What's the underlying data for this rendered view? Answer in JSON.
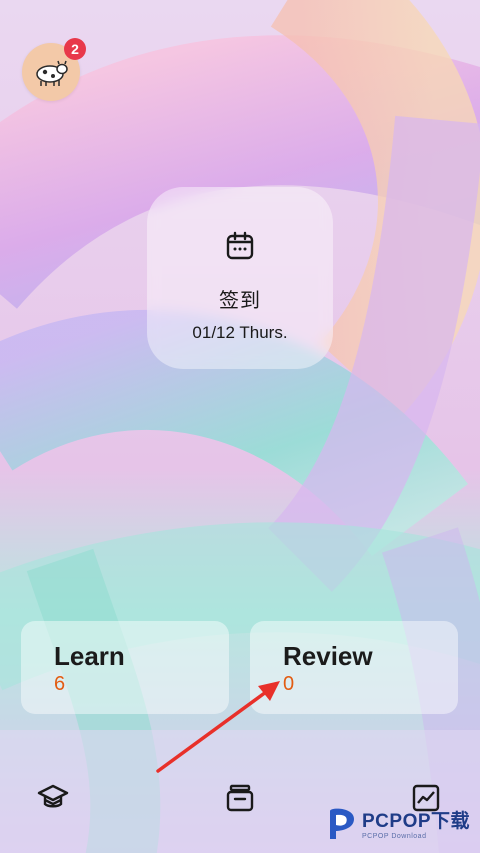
{
  "profile": {
    "notification_count": "2",
    "avatar_icon": "cow-avatar"
  },
  "checkin": {
    "title": "签到",
    "date": "01/12 Thurs.",
    "icon": "calendar-icon"
  },
  "stats": {
    "learn": {
      "label": "Learn",
      "value": "6"
    },
    "review": {
      "label": "Review",
      "value": "0"
    }
  },
  "tabbar": {
    "items": [
      {
        "icon": "graduation-cap-icon"
      },
      {
        "icon": "archive-box-icon"
      },
      {
        "icon": "trend-chart-icon"
      }
    ]
  },
  "watermark": {
    "main": "PCPOP下载",
    "sub": "PCPOP Download"
  },
  "colors": {
    "accent_value": "#e25c12",
    "badge": "#e8384a",
    "arrow": "#e8302a"
  }
}
